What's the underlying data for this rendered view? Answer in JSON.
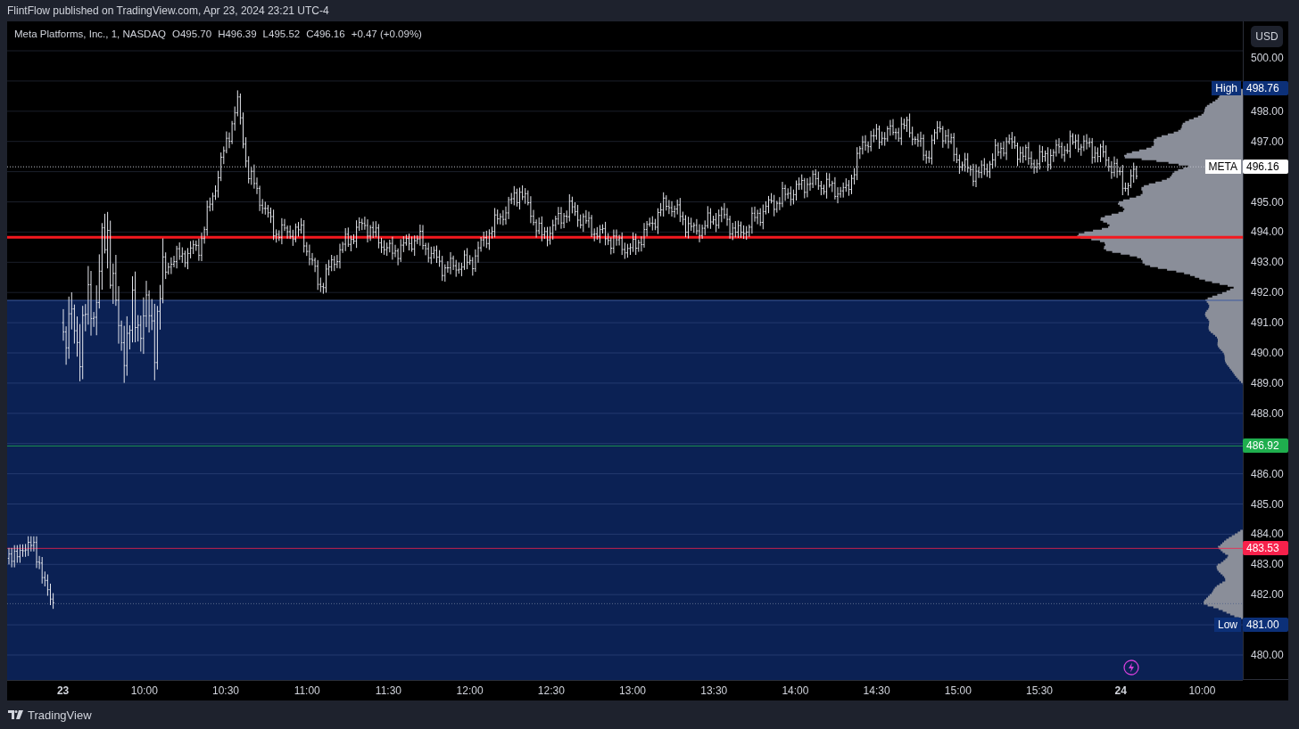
{
  "publish_line": "FlintFlow published on TradingView.com, Apr 23, 2024 23:21 UTC-4",
  "legend": {
    "symbol": "Meta Platforms, Inc., 1, NASDAQ",
    "open": "O495.70",
    "high": "H496.39",
    "low": "L495.52",
    "close": "C496.16",
    "change": "+0.47 (+0.09%)"
  },
  "currency_button": "USD",
  "price_axis": {
    "ticks": [
      "500.00",
      "498.00",
      "497.00",
      "495.00",
      "494.00",
      "493.00",
      "492.00",
      "491.00",
      "490.00",
      "489.00",
      "488.00",
      "486.00",
      "485.00",
      "484.00",
      "483.00",
      "482.00",
      "480.00"
    ]
  },
  "price_labels": [
    {
      "kind": "high",
      "caption": "High",
      "value": "498.76"
    },
    {
      "kind": "last",
      "caption": "META",
      "value": "496.16"
    },
    {
      "kind": "line",
      "value": "486.92",
      "color": "#1fae4e"
    },
    {
      "kind": "line",
      "value": "483.53",
      "color": "#f7214b"
    },
    {
      "kind": "low",
      "caption": "Low",
      "value": "481.00"
    }
  ],
  "time_axis": [
    {
      "kind": "day",
      "label": "23"
    },
    {
      "kind": "time",
      "label": "10:00"
    },
    {
      "kind": "time",
      "label": "10:30"
    },
    {
      "kind": "time",
      "label": "11:00"
    },
    {
      "kind": "time",
      "label": "11:30"
    },
    {
      "kind": "time",
      "label": "12:00"
    },
    {
      "kind": "time",
      "label": "12:30"
    },
    {
      "kind": "time",
      "label": "13:00"
    },
    {
      "kind": "time",
      "label": "13:30"
    },
    {
      "kind": "time",
      "label": "14:00"
    },
    {
      "kind": "time",
      "label": "14:30"
    },
    {
      "kind": "time",
      "label": "15:00"
    },
    {
      "kind": "time",
      "label": "15:30"
    },
    {
      "kind": "day",
      "label": "24"
    },
    {
      "kind": "time",
      "label": "10:00"
    }
  ],
  "footer_brand": "TradingView"
}
